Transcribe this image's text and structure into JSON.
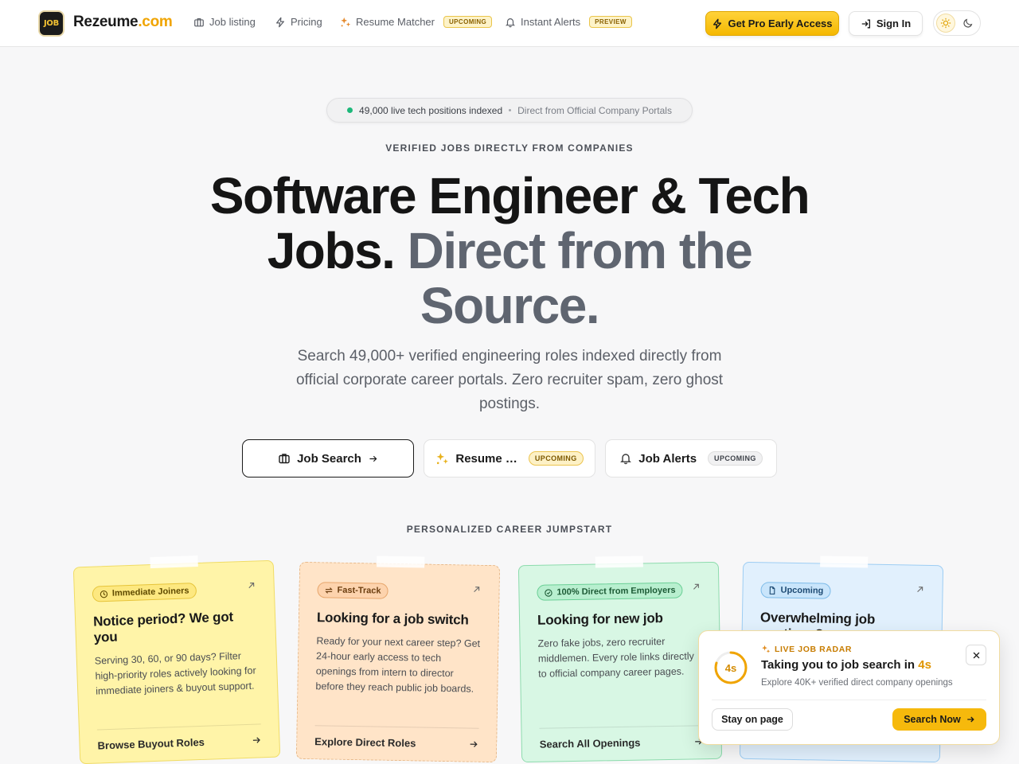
{
  "nav": {
    "logo_text": "JOB",
    "brand_name": "Rezeume",
    "brand_tld": ".com",
    "links": [
      {
        "label": "Job listing",
        "icon": "briefcase-icon"
      },
      {
        "label": "Pricing",
        "icon": "bolt-icon"
      },
      {
        "label": "Resume Matcher",
        "icon": "sparkles-icon",
        "badge": "UPCOMING"
      },
      {
        "label": "Instant Alerts",
        "icon": "bell-icon",
        "badge": "PREVIEW"
      }
    ],
    "pro_button": "Get Pro Early Access",
    "signin_button": "Sign In"
  },
  "hero": {
    "status_primary": "49,000 live tech positions indexed",
    "status_secondary": "Direct from Official Company Portals",
    "eyebrow": "VERIFIED JOBS DIRECTLY FROM COMPANIES",
    "title_dark": "Software Engineer & Tech Jobs.",
    "title_grey": "Direct from the Source.",
    "subtitle": "Search 49,000+ verified engineering roles indexed directly from official corporate career portals. Zero recruiter spam, zero ghost postings.",
    "ctas": [
      {
        "label": "Job Search"
      },
      {
        "label": "Resume …",
        "badge": "UPCOMING"
      },
      {
        "label": "Job Alerts",
        "badge": "UPCOMING"
      }
    ]
  },
  "jumpstart": {
    "heading": "PERSONALIZED CAREER JUMPSTART",
    "cards": [
      {
        "badge": "Immediate Joiners",
        "title": "Notice period? We got you",
        "body": "Serving 30, 60, or 90 days? Filter high-priority roles actively looking for immediate joiners & buyout support.",
        "footer": "Browse Buyout Roles"
      },
      {
        "badge": "Fast-Track",
        "title": "Looking for a job switch",
        "body": "Ready for your next career step? Get 24-hour early access to tech openings from intern to director before they reach public job boards.",
        "footer": "Explore Direct Roles"
      },
      {
        "badge": "100% Direct from Employers",
        "title": "Looking for new job",
        "body": "Zero fake jobs, zero recruiter middlemen. Every role links directly to official company career pages.",
        "footer": "Search All Openings"
      },
      {
        "badge": "Upcoming",
        "title": "Overwhelming job postings?",
        "body": "",
        "footer": ""
      }
    ]
  },
  "popup": {
    "countdown": "4s",
    "countdown_fraction": 0.8,
    "eyebrow": "LIVE JOB RADAR",
    "title_prefix": "Taking you to job search in ",
    "title_seconds": "4s",
    "subtitle": "Explore 40K+ verified direct company openings",
    "stay_button": "Stay on page",
    "go_button": "Search Now"
  },
  "colors": {
    "accent": "#f5b800",
    "status_dot": "#1db87a"
  }
}
